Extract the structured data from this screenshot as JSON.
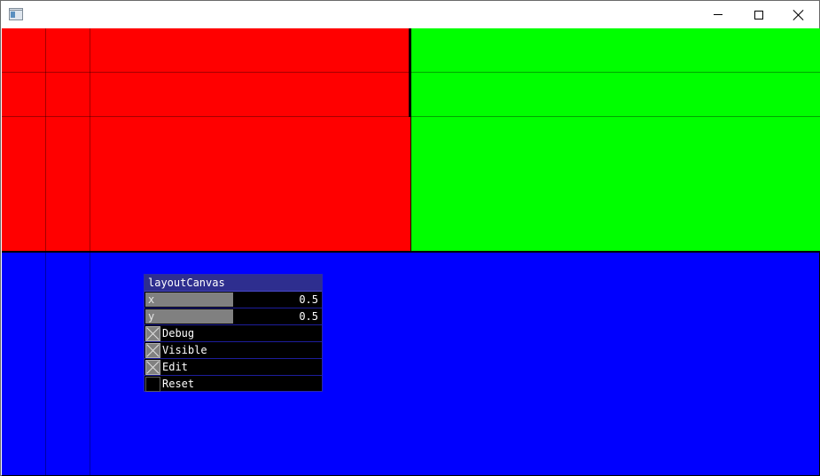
{
  "window": {
    "icon": "app-window-icon",
    "controls": [
      "minimize-icon",
      "maximize-icon",
      "close-icon"
    ]
  },
  "panes": [
    {
      "id": "red",
      "color": "#ff0000"
    },
    {
      "id": "green",
      "color": "#00ff00"
    },
    {
      "id": "blue",
      "color": "#0000ff"
    }
  ],
  "panel": {
    "title": "layoutCanvas",
    "sliders": [
      {
        "label": "x",
        "value": "0.5",
        "level": 0.5
      },
      {
        "label": "y",
        "value": "0.5",
        "level": 0.5
      }
    ],
    "toggles": [
      {
        "label": "Debug",
        "checked": true
      },
      {
        "label": "Visible",
        "checked": true
      },
      {
        "label": "Edit",
        "checked": true
      },
      {
        "label": "Reset",
        "checked": false
      }
    ],
    "colors": {
      "title_bg": "#2e2e8f",
      "border": "#1d1d9c",
      "fill": "#808080"
    }
  }
}
